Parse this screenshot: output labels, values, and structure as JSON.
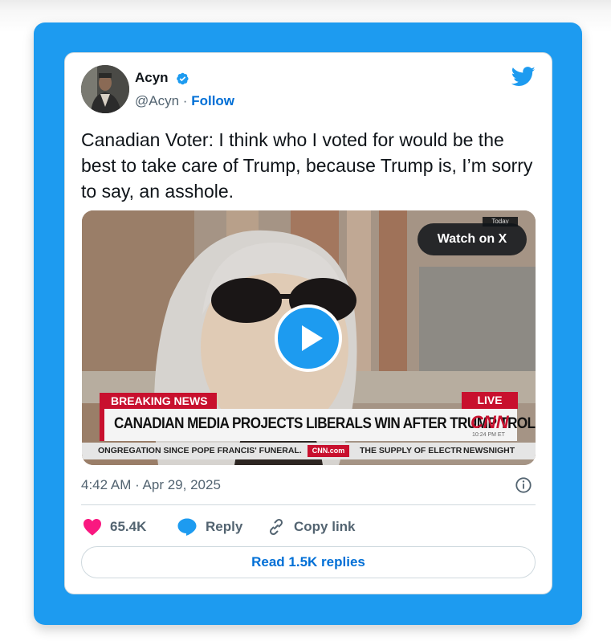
{
  "author": {
    "name": "Acyn",
    "handle": "@Acyn",
    "separator": "·",
    "follow_label": "Follow"
  },
  "tweet": {
    "text": "Canadian Voter: I think who I voted for would be the best to take care of Trump, because Trump is, I’m sorry to say, an asshole.",
    "timestamp": "4:42 AM · Apr 29, 2025"
  },
  "media": {
    "watch_label": "Watch on X",
    "today_tag": "Today",
    "breaking_label": "BREAKING NEWS",
    "live_label": "LIVE",
    "headline": "CANADIAN MEDIA PROJECTS LIBERALS WIN AFTER TRUMP TROLLS",
    "network_logo": "CNN",
    "network_time": "10:24 PM ET",
    "ticker_left": "ONGREGATION SINCE POPE FRANCIS' FUNERAL.",
    "ticker_site": "CNN.com",
    "ticker_right": "THE SUPPLY OF ELECTR",
    "ticker_show": "NEWSNIGHT"
  },
  "actions": {
    "likes": "65.4K",
    "reply_label": "Reply",
    "copy_label": "Copy link"
  },
  "read_replies_label": "Read 1.5K replies",
  "colors": {
    "accent": "#1d9bf0",
    "link": "#006fd6",
    "heart": "#f91880",
    "cnn_red": "#c8102e"
  },
  "icons": [
    "verified-badge-icon",
    "twitter-bird-icon",
    "play-icon",
    "info-icon",
    "heart-icon",
    "reply-bubble-icon",
    "link-icon"
  ]
}
